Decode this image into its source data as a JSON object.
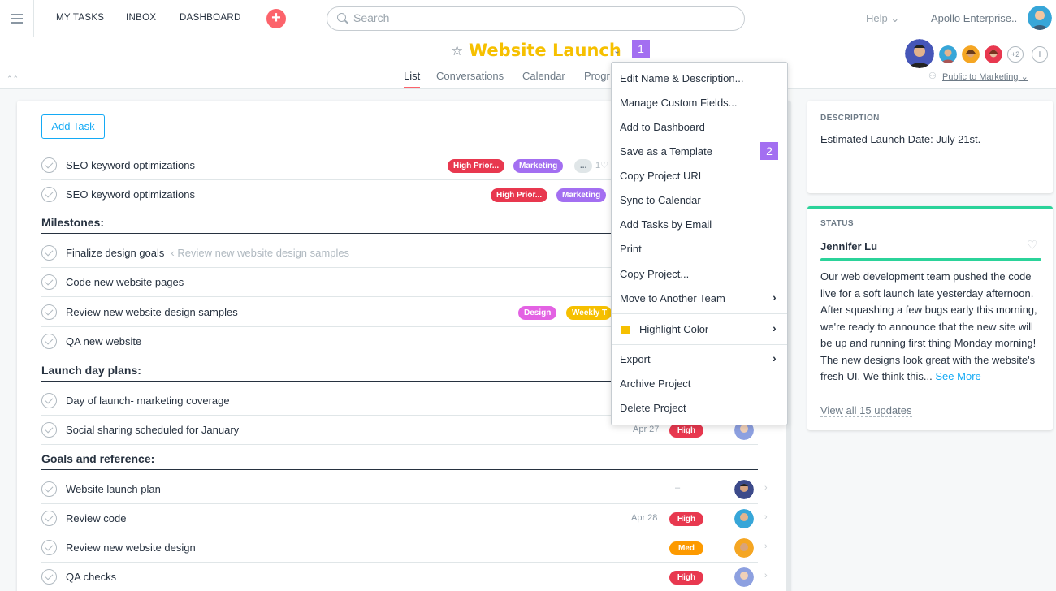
{
  "nav": {
    "links": [
      "MY TASKS",
      "INBOX",
      "DASHBOARD"
    ],
    "add_icon": "plus-icon",
    "search_placeholder": "Search",
    "help": "Help ⌄",
    "org": "Apollo Enterprise.."
  },
  "project": {
    "title": "Website Launch",
    "dropdown_chev": "⌄",
    "tabs": [
      "List",
      "Conversations",
      "Calendar",
      "Progr"
    ],
    "member_more": "+2",
    "add_member": "+",
    "privacy": "Public to Marketing ⌄"
  },
  "badges": {
    "one": "1",
    "two": "2"
  },
  "list": {
    "add_task": "Add Task",
    "rows": [
      {
        "text": "SEO keyword optimizations",
        "tags": [
          "High Prior...",
          "Marketing",
          "..."
        ],
        "extra": "1♡"
      },
      {
        "text": "SEO keyword optimizations",
        "tags": [
          "High Prior...",
          "Marketing"
        ]
      }
    ],
    "sections": [
      {
        "name": "Milestones:"
      },
      {
        "name": "Launch day plans:"
      },
      {
        "name": "Goals and reference:"
      }
    ],
    "milestones": [
      {
        "text": "Finalize design goals",
        "sub": "‹ Review new website design samples"
      },
      {
        "text": "Code new website pages"
      },
      {
        "text": "Review new website design samples",
        "tags": [
          "Design",
          "Weekly T"
        ]
      },
      {
        "text": "QA new website"
      }
    ],
    "launch": [
      {
        "text": "Day of launch- marketing coverage"
      },
      {
        "text": "Social sharing scheduled for January",
        "date": "Apr 27",
        "pri": "High"
      }
    ],
    "goals": [
      {
        "text": "Website launch plan",
        "date": "–"
      },
      {
        "text": "Review code",
        "date": "Apr 28",
        "pri": "High"
      },
      {
        "text": "Review new website design",
        "pri": "Med"
      },
      {
        "text": "QA checks",
        "pri": "High"
      }
    ]
  },
  "menu": {
    "items": [
      "Edit Name & Description...",
      "Manage Custom Fields...",
      "Add to Dashboard",
      "Save as a Template",
      "Copy Project URL",
      "Sync to Calendar",
      "Add Tasks by Email",
      "Print",
      "Copy Project...",
      "Move to Another Team",
      "Highlight Color",
      "Export",
      "Archive Project",
      "Delete Project"
    ],
    "arrow": "›"
  },
  "description": {
    "caption": "DESCRIPTION",
    "text": "Estimated Launch Date: July 21st."
  },
  "status": {
    "caption": "STATUS",
    "author": "Jennifer Lu",
    "body": "Our web development team pushed the code live for a soft launch late yesterday afternoon. After squashing a few bugs early this morning, we're ready to announce that the new site will be up and running first thing Monday morning! The new designs look great with the website's fresh UI. We think this...",
    "see_more": "See More",
    "view_all": "View all 15 updates"
  },
  "colors": {
    "accent": "#fc636b",
    "title": "#f6c000",
    "link": "#14aaf5",
    "status_green": "#2bd39a",
    "high_priority": "#e8384f",
    "marketing": "#a36ff1",
    "design": "#e362e3",
    "weekly": "#f6c000",
    "med": "#fd9a00"
  }
}
